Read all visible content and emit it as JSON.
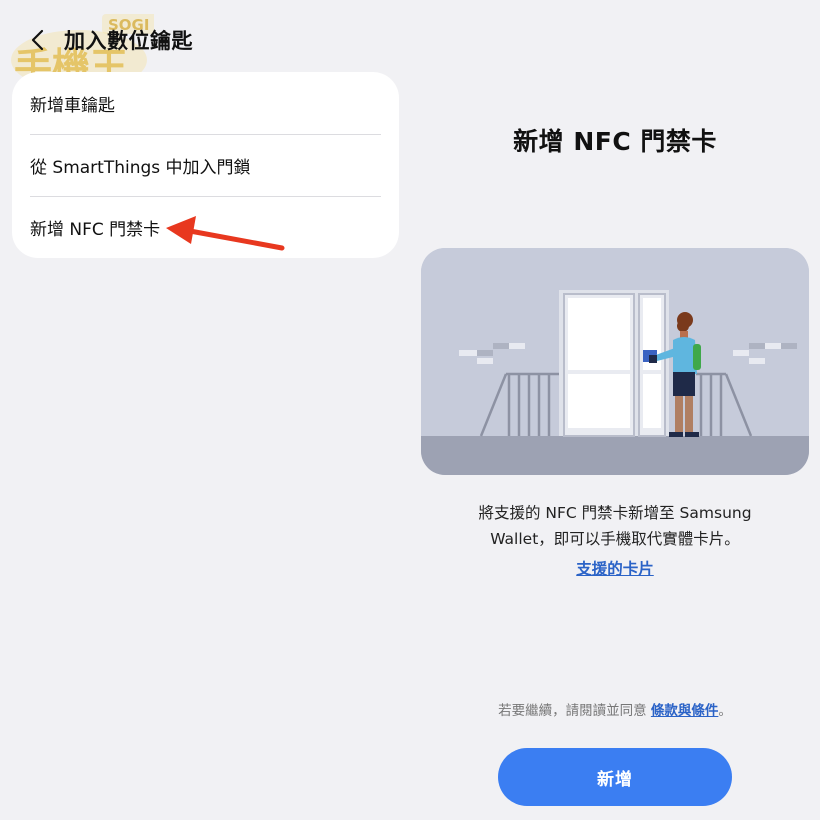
{
  "watermark": {
    "label": "SOGI",
    "glyphs": "手機王"
  },
  "header": {
    "back_icon": "chevron-left-icon",
    "title": "加入數位鑰匙"
  },
  "options": [
    {
      "label": "新增車鑰匙"
    },
    {
      "label": "從 SmartThings 中加入門鎖"
    },
    {
      "label": "新增 NFC 門禁卡"
    }
  ],
  "annotation": {
    "arrow_color": "#e8381f"
  },
  "detail": {
    "title": "新增 NFC 門禁卡",
    "description_line1": "將支援的 NFC 門禁卡新增至 Samsung",
    "description_line2": "Wallet，即可以手機取代實體卡片。",
    "supported_link": "支援的卡片",
    "terms_prefix": "若要繼續，請閱讀並同意 ",
    "terms_link": "條款與條件",
    "terms_suffix": "。",
    "add_button": "新增"
  },
  "colors": {
    "background": "#f1f1f4",
    "accent": "#3b7ef2",
    "link": "#2b63c7"
  }
}
